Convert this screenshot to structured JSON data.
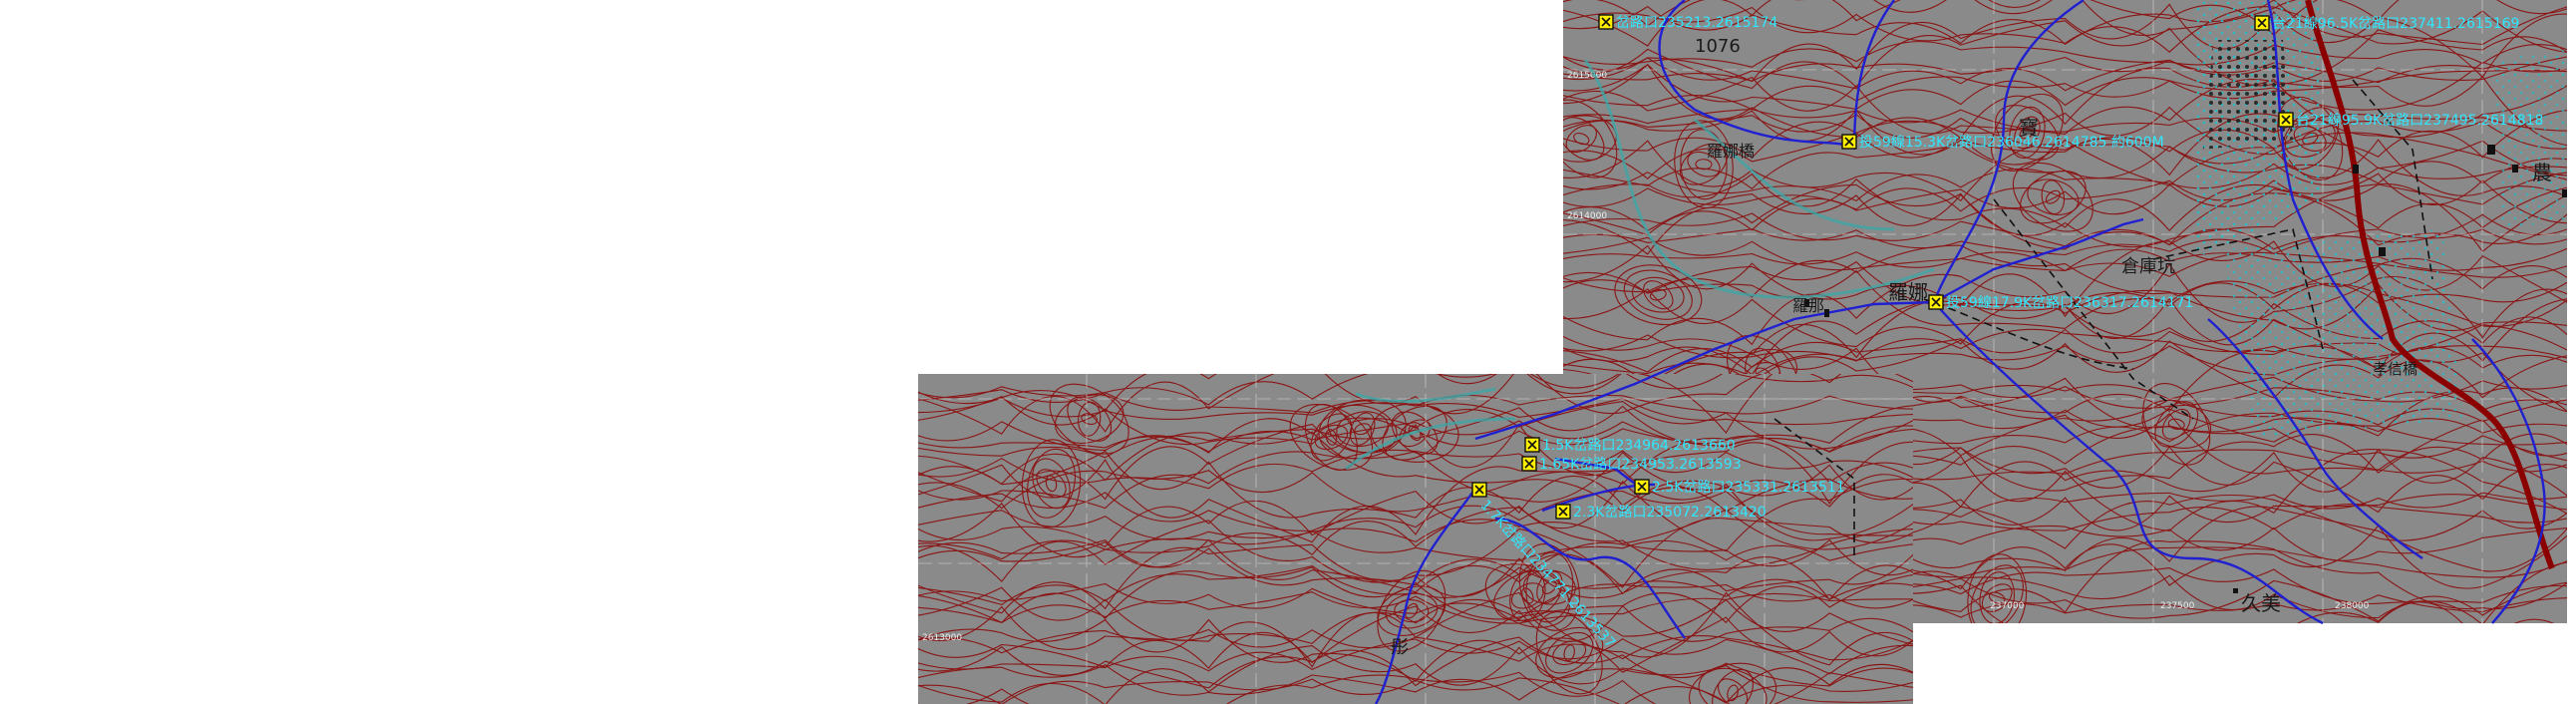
{
  "colors": {
    "terrain": "#8a8a8a",
    "contour": "#8b1515",
    "route": "#2020d0",
    "road": "#8b0000",
    "label": "#2ee8ff",
    "marker_fill": "#ffee00",
    "dots": "#20c0c8"
  },
  "icons": {
    "waypoint": "waypoint-marker-icon"
  },
  "waypoints": [
    {
      "label": "岔路口235213.2615174"
    },
    {
      "label": "台21線96.5K岔路口237411.2615169"
    },
    {
      "label": "台21線95.9K岔路口237495.2614818"
    },
    {
      "label": "投59線15.3K岔路口236046.2614785 約600M"
    },
    {
      "label": "投59線17.9K岔路口236317.2614171"
    },
    {
      "label": "1.5K岔路口234964.2613660"
    },
    {
      "label": "1.65K岔路口234953.2613593"
    },
    {
      "label": "2.5K岔路口235331.2613511"
    },
    {
      "label": "2.3K岔路口235072.2613420"
    },
    {
      "label": "1.7K岔路口234771.2613537"
    }
  ],
  "place_names": [
    {
      "label": "1076"
    },
    {
      "label": "羅娜橋"
    },
    {
      "label": "羅那"
    },
    {
      "label": "羅娜"
    },
    {
      "label": "倉庫坑"
    },
    {
      "label": "孝信橋"
    },
    {
      "label": "久美"
    },
    {
      "label": "農"
    },
    {
      "label": "寶"
    },
    {
      "label": "彤"
    }
  ],
  "grid_labels": [
    {
      "label": "2615000"
    },
    {
      "label": "2614000"
    },
    {
      "label": "2613000"
    },
    {
      "label": "237000"
    },
    {
      "label": "237500"
    },
    {
      "label": "238000"
    }
  ]
}
